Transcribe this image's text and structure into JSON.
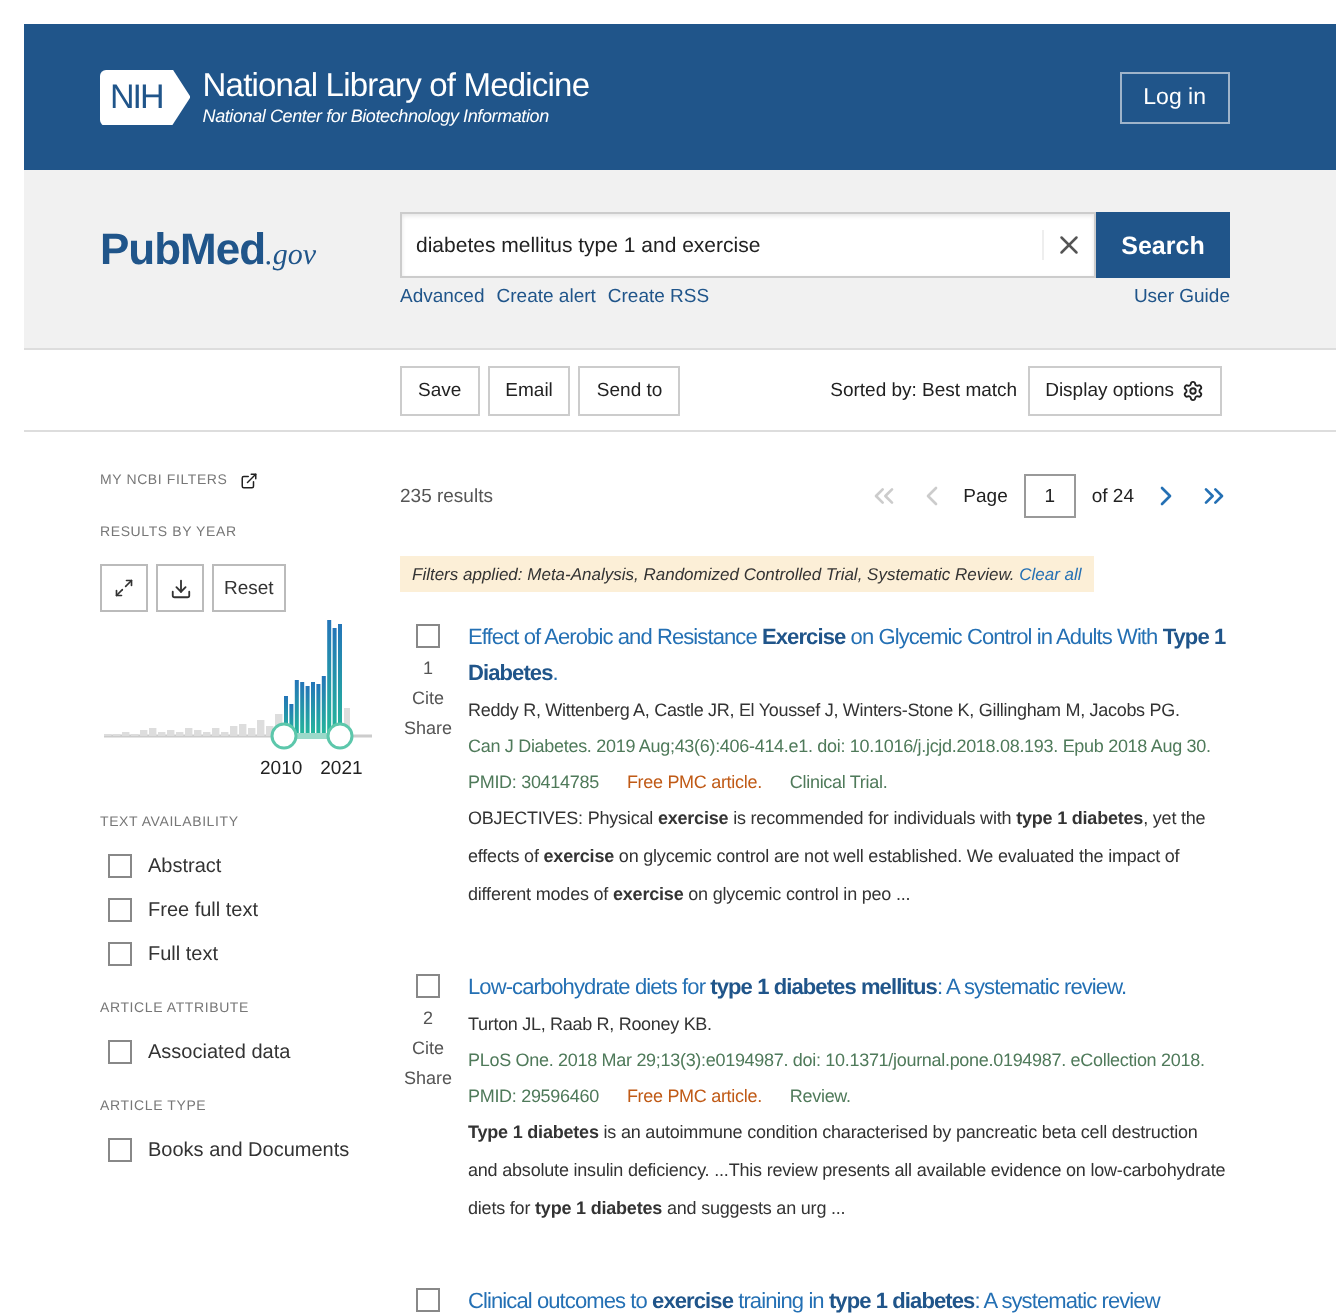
{
  "header": {
    "logo": "NIH",
    "title": "National Library of Medicine",
    "subtitle": "National Center for Biotechnology Information",
    "login": "Log in"
  },
  "search": {
    "brand": "PubMed",
    "brand_suffix": ".gov",
    "value": "diabetes mellitus type 1 and exercise",
    "button": "Search",
    "links": [
      "Advanced",
      "Create alert",
      "Create RSS"
    ],
    "user_guide": "User Guide"
  },
  "actions": {
    "buttons": [
      "Save",
      "Email",
      "Send to"
    ],
    "sort": "Sorted by: Best match",
    "display_options": "Display options"
  },
  "sidebar": {
    "ncbi_filters": "MY NCBI FILTERS",
    "sections": [
      {
        "kind": "histogram",
        "heading": "RESULTS BY YEAR",
        "reset": "Reset",
        "year_start": "2010",
        "year_end": "2021"
      },
      {
        "kind": "checkboxes",
        "heading": "TEXT AVAILABILITY",
        "items": [
          {
            "label": "Abstract",
            "checked": false
          },
          {
            "label": "Free full text",
            "checked": false
          },
          {
            "label": "Full text",
            "checked": false
          }
        ]
      },
      {
        "kind": "checkboxes",
        "heading": "ARTICLE ATTRIBUTE",
        "items": [
          {
            "label": "Associated data",
            "checked": false
          }
        ]
      },
      {
        "kind": "checkboxes",
        "heading": "ARTICLE TYPE",
        "items": [
          {
            "label": "Books and Documents",
            "checked": false
          }
        ]
      }
    ]
  },
  "results": {
    "count": "235 results",
    "page_label": "Page",
    "page": "1",
    "of_pages": "of 24",
    "filters_applied": "Filters applied: Meta-Analysis, Randomized Controlled Trial, Systematic Review.",
    "clear_all": "Clear all",
    "items": [
      {
        "checked": false,
        "number": "1",
        "cite": "Cite",
        "share": "Share",
        "title": "Effect of Aerobic and Resistance **Exercise** on Glycemic Control in Adults With **Type 1 Diabetes**.",
        "authors": "Reddy R, Wittenberg A, Castle JR, El Youssef J, Winters-Stone K, Gillingham M, Jacobs PG.",
        "citation": "Can J Diabetes. 2019 Aug;43(6):406-414.e1. doi: 10.1016/j.jcjd.2018.08.193. Epub 2018 Aug 30.",
        "pmid": "PMID: 30414785",
        "free": "Free PMC article.",
        "type": "Clinical Trial.",
        "abstract": "OBJECTIVES: Physical **exercise** is recommended for individuals with **type 1 diabetes**, yet the effects of **exercise** on glycemic control are not well established. We evaluated the impact of different modes of **exercise** on glycemic control in peo ..."
      },
      {
        "checked": false,
        "number": "2",
        "cite": "Cite",
        "share": "Share",
        "title": "Low-carbohydrate diets for **type 1 diabetes mellitus**: A systematic review.",
        "authors": "Turton JL, Raab R, Rooney KB.",
        "citation": "PLoS One. 2018 Mar 29;13(3):e0194987. doi: 10.1371/journal.pone.0194987. eCollection 2018.",
        "pmid": "PMID: 29596460",
        "free": "Free PMC article.",
        "type": "Review.",
        "abstract": "**Type 1 diabetes** is an autoimmune condition characterised by pancreatic beta cell destruction and absolute insulin deficiency. ...This review presents all available evidence on low-carbohydrate diets for **type 1 diabetes** and suggests an urg ..."
      },
      {
        "checked": false,
        "title": "Clinical outcomes to **exercise** training in **type 1 diabetes**: A systematic review"
      }
    ]
  }
}
